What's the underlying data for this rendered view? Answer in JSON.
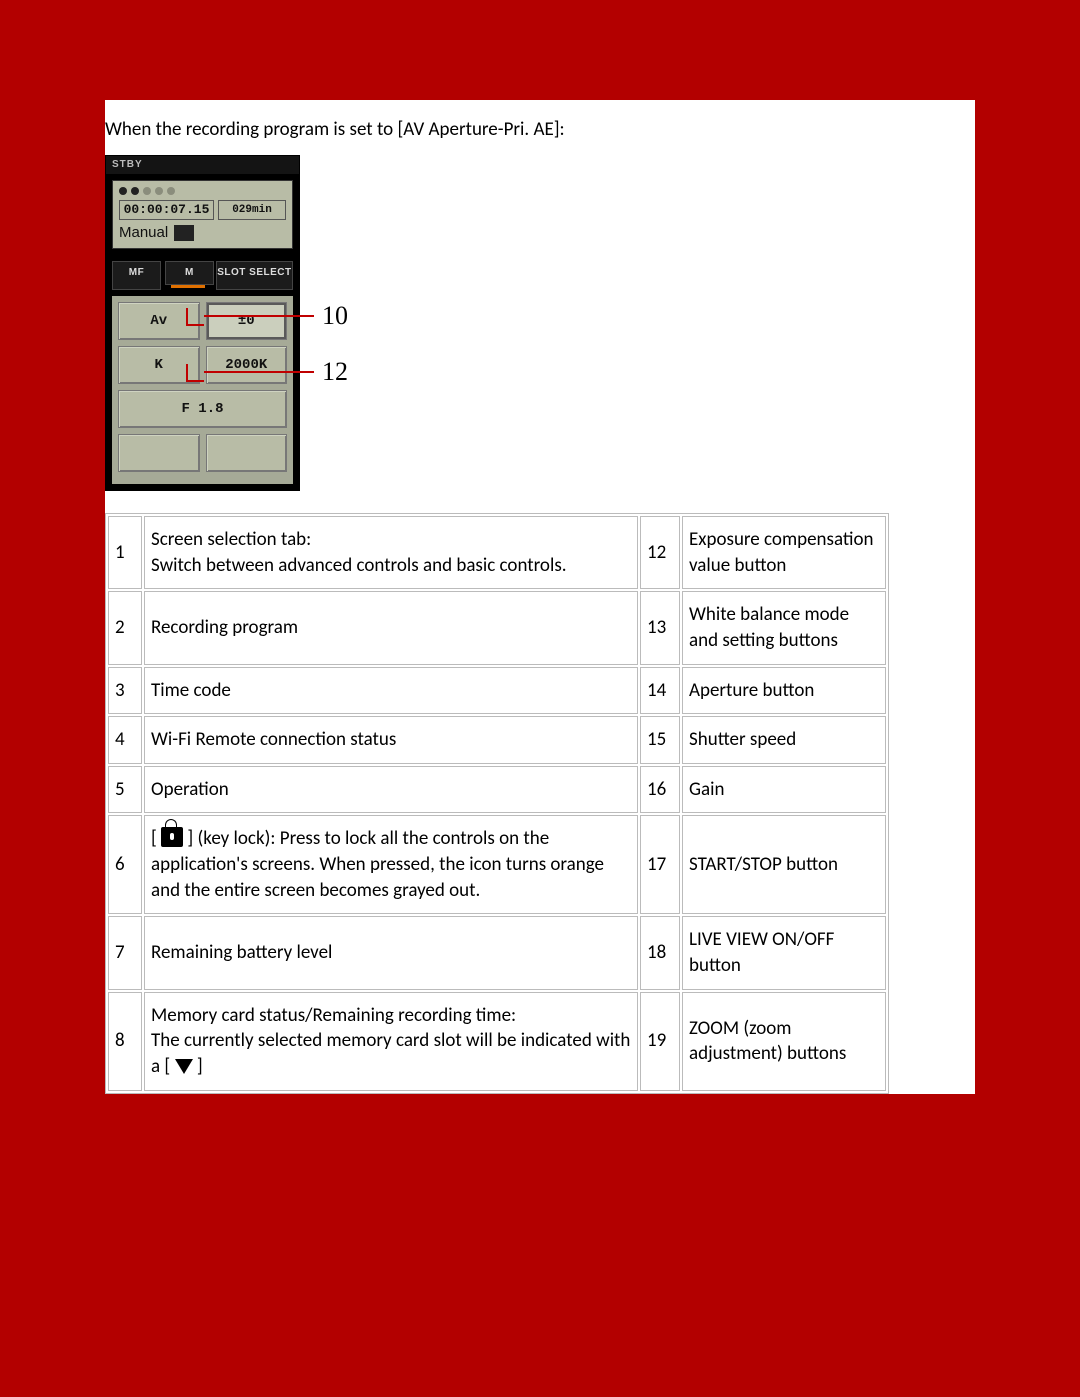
{
  "intro": "When the recording program is set to [AV Aperture-Pri. AE]:",
  "device": {
    "status": "STBY",
    "timecode": "00:00:07.15",
    "remaining": "029min",
    "mode_label": "Manual",
    "btn_mf": "MF",
    "btn_m": "M",
    "btn_slot": "SLOT SELECT",
    "av_label": "Av",
    "ev_value": "±0",
    "wb_mode": "K",
    "wb_value": "2000K",
    "aperture": "F 1.8"
  },
  "callout_10": "10",
  "callout_12": "12",
  "legend_left": [
    {
      "n": "1",
      "text": "Screen selection tab:\nSwitch between advanced controls and basic controls."
    },
    {
      "n": "2",
      "text": "Recording program"
    },
    {
      "n": "3",
      "text": "Time code"
    },
    {
      "n": "4",
      "text": "Wi-Fi Remote connection status"
    },
    {
      "n": "5",
      "text": "Operation"
    },
    {
      "n": "6",
      "pre": "[ ",
      "post": " ] (key lock): Press to lock all the controls on the application's screens. When pressed, the icon turns orange and the entire screen becomes grayed out."
    },
    {
      "n": "7",
      "text": "Remaining battery level"
    },
    {
      "n": "8",
      "line1": "Memory card status/Remaining recording time:",
      "line2_pre": "The currently selected memory card slot will be indicated with a [ ",
      "line2_post": " ]"
    }
  ],
  "legend_right": [
    {
      "n": "12",
      "text": "Exposure compensation value button"
    },
    {
      "n": "13",
      "text": "White balance mode and setting buttons"
    },
    {
      "n": "14",
      "text": "Aperture button"
    },
    {
      "n": "15",
      "text": "Shutter speed"
    },
    {
      "n": "16",
      "text": "Gain"
    },
    {
      "n": "17",
      "text": "START/STOP button"
    },
    {
      "n": "18",
      "text": "LIVE VIEW ON/OFF button"
    },
    {
      "n": "19",
      "text": "ZOOM (zoom adjustment) buttons"
    }
  ]
}
